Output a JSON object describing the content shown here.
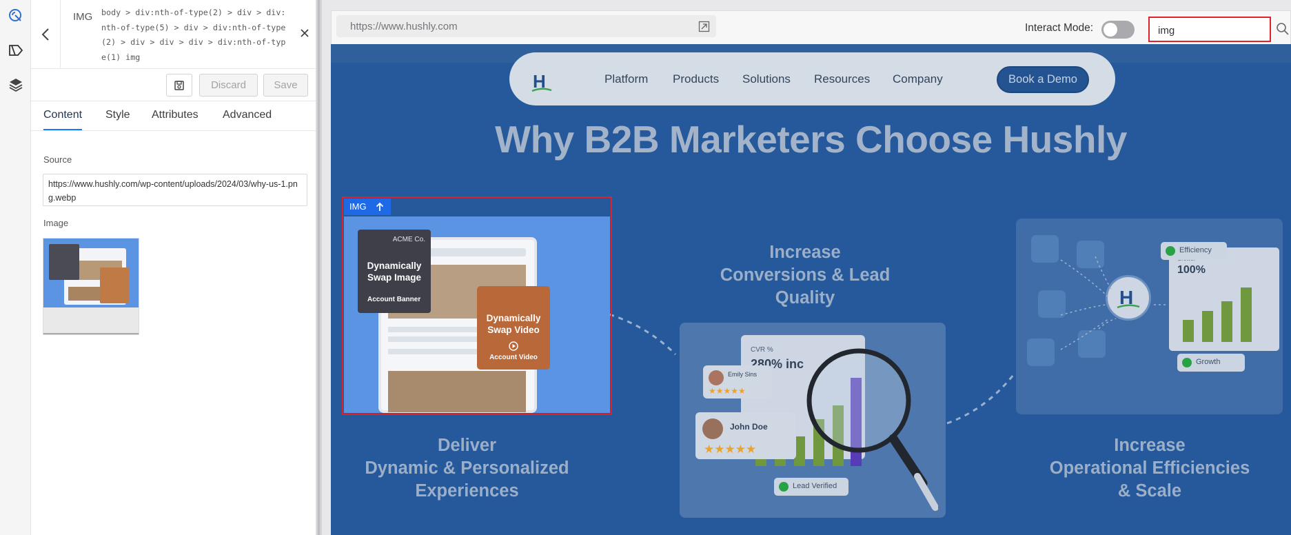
{
  "panel": {
    "tag": "IMG",
    "selector": "body > div:nth-of-type(2) > div > div:nth-of-type(5) > div > div:nth-of-type(2) > div > div > div > div:nth-of-type(1) img",
    "actions": {
      "discard": "Discard",
      "save": "Save"
    },
    "tabs": [
      "Content",
      "Style",
      "Attributes",
      "Advanced"
    ],
    "source_label": "Source",
    "source_value": "https://www.hushly.com/wp-content/uploads/2024/03/why-us-1.png.webp",
    "image_label": "Image"
  },
  "toolbar": {
    "url": "https://www.hushly.com",
    "interact_label": "Interact Mode:",
    "interact_on": false,
    "search_value": "img"
  },
  "site": {
    "logo_letter": "H",
    "nav": [
      "Platform",
      "Products",
      "Solutions",
      "Resources",
      "Company"
    ],
    "cta": "Book a Demo",
    "headline": "Why B2B Marketers Choose Hushly",
    "col_left": [
      "Deliver",
      "Dynamic & Personalized",
      "Experiences"
    ],
    "col_mid": [
      "Increase",
      "Conversions & Lead",
      "Quality"
    ],
    "col_right": [
      "Increase",
      "Operational Efficiencies",
      "& Scale"
    ],
    "img_tag": "IMG",
    "img_card": {
      "company": "ACME Co.",
      "banner_title_1": "Dynamically",
      "banner_title_2": "Swap Image",
      "banner_caption": "Account Banner",
      "video_title_1": "Dynamically",
      "video_title_2": "Swap Video",
      "video_caption": "Account Video"
    },
    "mid_card": {
      "metric_label": "CVR %",
      "metric_value": "280% inc",
      "reviewer_1": "Emily Sins",
      "reviewer_2": "John Doe",
      "stars": "★★★★★",
      "verified": "Lead Verified"
    },
    "right_card": {
      "badge_top": "Efficiency",
      "growth_label": "Growth",
      "growth_value": "100%",
      "badge_bottom": "Growth"
    }
  }
}
